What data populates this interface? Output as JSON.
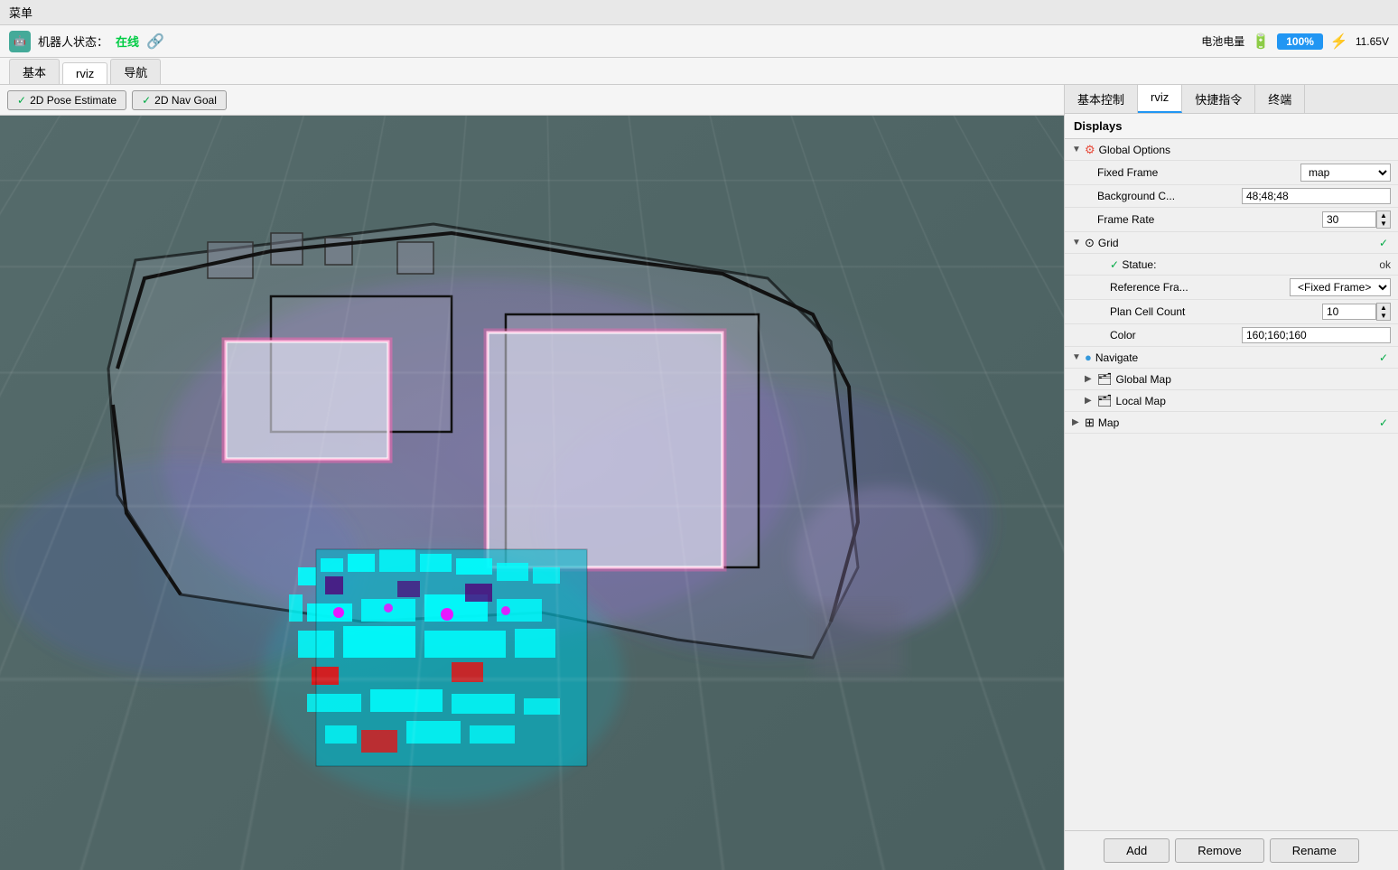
{
  "menubar": {
    "label": "菜单"
  },
  "header": {
    "robot_label": "机器人状态：",
    "status": "在线",
    "battery_label": "电池电量",
    "battery_percent": "100%",
    "voltage": "11.65V"
  },
  "tabs_top": [
    {
      "id": "basic",
      "label": "基本",
      "active": false
    },
    {
      "id": "rviz",
      "label": "rviz",
      "active": true
    },
    {
      "id": "nav",
      "label": "导航",
      "active": false
    }
  ],
  "toolbar": {
    "pose_btn": "2D Pose Estimate",
    "nav_btn": "2D Nav Goal"
  },
  "tabs_right": [
    {
      "id": "basic-ctrl",
      "label": "基本控制",
      "active": false
    },
    {
      "id": "rviz",
      "label": "rviz",
      "active": true
    },
    {
      "id": "shortcuts",
      "label": "快捷指令",
      "active": false
    },
    {
      "id": "terminal",
      "label": "终端",
      "active": false
    }
  ],
  "displays": {
    "header": "Displays",
    "items": [
      {
        "indent": 0,
        "expand": true,
        "icon": "⚙",
        "icon_color": "#e74c3c",
        "label": "Global Options",
        "value": ""
      },
      {
        "indent": 1,
        "label": "Fixed Frame",
        "value": "map",
        "type": "select"
      },
      {
        "indent": 1,
        "label": "Background C...",
        "value": "48;48;48",
        "type": "input"
      },
      {
        "indent": 1,
        "label": "Frame Rate",
        "value": "30",
        "type": "spinner"
      },
      {
        "indent": 0,
        "expand": true,
        "icon": "⊙",
        "icon_color": "#555",
        "label": "Grid",
        "value": "✓",
        "check": true
      },
      {
        "indent": 1,
        "label": "✓ Statue:",
        "value": "ok"
      },
      {
        "indent": 1,
        "label": "Reference Fra...",
        "value": "<Fixed Frame>",
        "type": "select"
      },
      {
        "indent": 1,
        "label": "Plan Cell Count",
        "value": "10",
        "type": "spinner"
      },
      {
        "indent": 1,
        "label": "Color",
        "value": "160;160;160",
        "type": "input"
      },
      {
        "indent": 0,
        "expand": true,
        "icon": "●",
        "icon_color": "#3498db",
        "label": "Navigate",
        "value": "✓",
        "check": true
      },
      {
        "indent": 1,
        "expand": true,
        "icon": "🗂",
        "label": "Global Map",
        "value": ""
      },
      {
        "indent": 1,
        "expand": false,
        "icon": "🗂",
        "label": "Local Map",
        "value": ""
      },
      {
        "indent": 0,
        "expand": false,
        "icon": "⊞",
        "label": "Map",
        "value": "✓",
        "check": true
      }
    ]
  },
  "bottom_buttons": [
    "Add",
    "Remove",
    "Rename"
  ]
}
